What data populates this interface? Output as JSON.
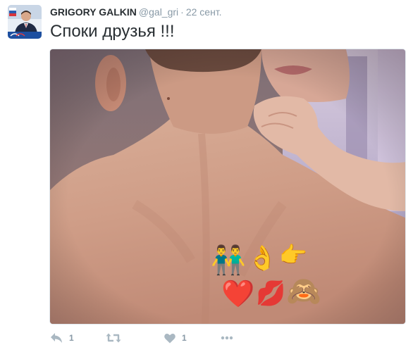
{
  "tweet": {
    "author_name": "GRIGORY GALKIN",
    "author_handle": "@gal_gri",
    "separator": "·",
    "timestamp": "22 сент.",
    "text": "Споки друзья !!!"
  },
  "media": {
    "emoji_overlay": [
      "👬",
      "👌",
      "👉",
      "❤️",
      "💋",
      "🙈"
    ]
  },
  "actions": {
    "reply_count": "1",
    "like_count": "1"
  },
  "icons": {
    "reply": "reply-icon",
    "retweet": "retweet-icon",
    "like": "heart-icon",
    "more": "more-icon"
  },
  "colors": {
    "name_text": "#292f33",
    "secondary_text": "#8899a6",
    "action_icon": "#aab8c2"
  }
}
